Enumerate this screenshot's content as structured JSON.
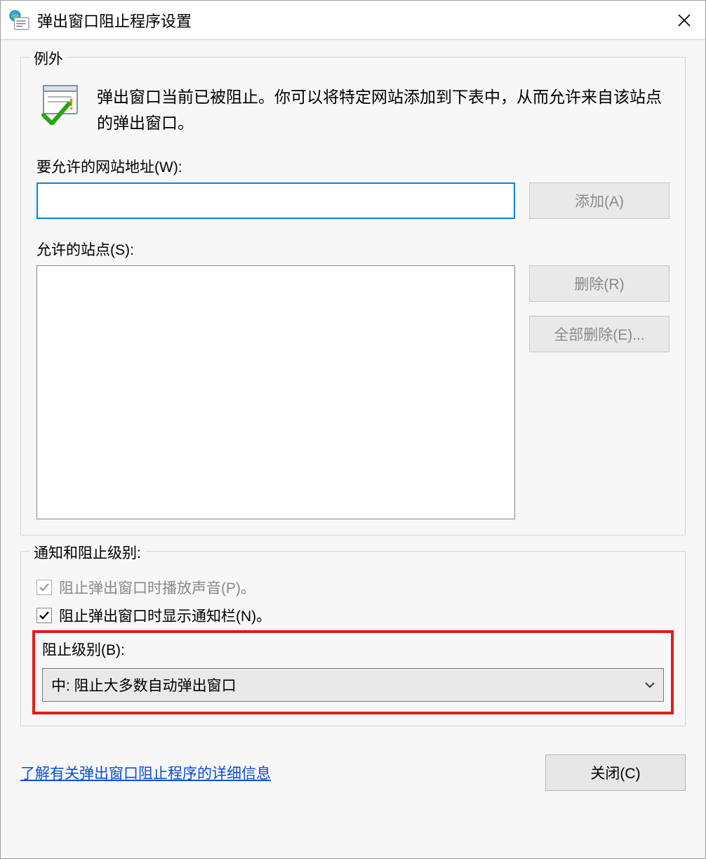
{
  "title": "弹出窗口阻止程序设置",
  "exceptions": {
    "legend": "例外",
    "description": "弹出窗口当前已被阻止。你可以将特定网站添加到下表中，从而允许来自该站点的弹出窗口。",
    "addressLabel": "要允许的网站地址(W):",
    "addressValue": "",
    "addBtn": "添加(A)",
    "allowedLabel": "允许的站点(S):",
    "removeBtn": "删除(R)",
    "removeAllBtn": "全部删除(E)..."
  },
  "notifications": {
    "legend": "通知和阻止级别:",
    "playSound": "阻止弹出窗口时播放声音(P)。",
    "showBar": "阻止弹出窗口时显示通知栏(N)。",
    "blockLevelLabel": "阻止级别(B):",
    "blockLevelValue": "中: 阻止大多数自动弹出窗口"
  },
  "footer": {
    "learnMore": "了解有关弹出窗口阻止程序的详细信息",
    "closeBtn": "关闭(C)"
  }
}
